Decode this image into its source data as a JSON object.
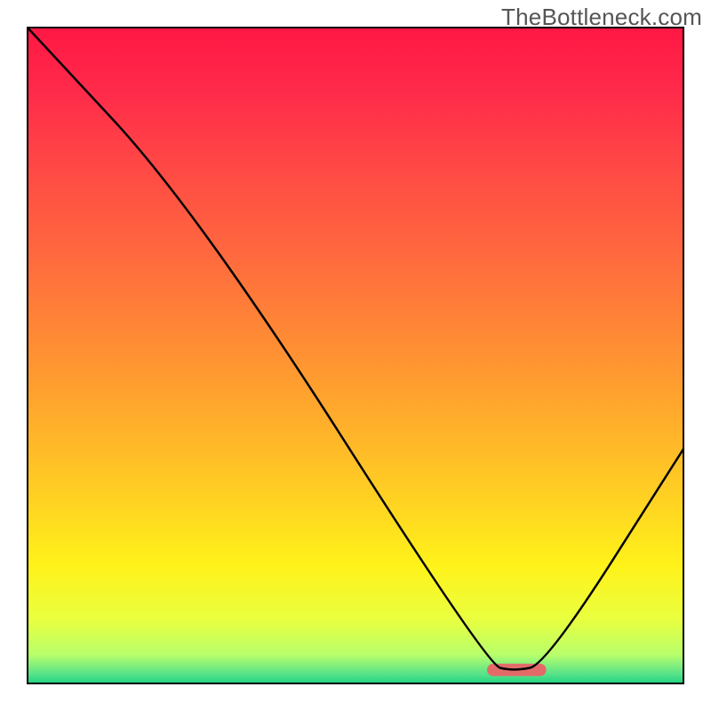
{
  "watermark": "TheBottleneck.com",
  "chart_data": {
    "type": "line",
    "title": "",
    "xlabel": "",
    "ylabel": "",
    "xlim": [
      0,
      100
    ],
    "ylim": [
      0,
      100
    ],
    "grid": false,
    "legend": false,
    "series": [
      {
        "name": "curve",
        "x": [
          0,
          26,
          70,
          74,
          79,
          100
        ],
        "y": [
          100,
          72,
          3,
          2,
          3,
          36
        ]
      }
    ],
    "highlight": {
      "xstart": 70,
      "xend": 79,
      "y": 2.2,
      "color": "#e46a6a"
    },
    "gradient_stops": [
      {
        "offset": 0.0,
        "color": "#ff1744"
      },
      {
        "offset": 0.1,
        "color": "#ff2b4a"
      },
      {
        "offset": 0.22,
        "color": "#ff4a45"
      },
      {
        "offset": 0.35,
        "color": "#ff6a3e"
      },
      {
        "offset": 0.48,
        "color": "#ff8c34"
      },
      {
        "offset": 0.6,
        "color": "#ffae2b"
      },
      {
        "offset": 0.72,
        "color": "#ffd222"
      },
      {
        "offset": 0.82,
        "color": "#fff21a"
      },
      {
        "offset": 0.9,
        "color": "#eaff3f"
      },
      {
        "offset": 0.955,
        "color": "#b8ff6b"
      },
      {
        "offset": 0.985,
        "color": "#55e28b"
      },
      {
        "offset": 1.0,
        "color": "#1bd17f"
      }
    ],
    "frame_color": "#000000",
    "curve_color": "#000000"
  }
}
